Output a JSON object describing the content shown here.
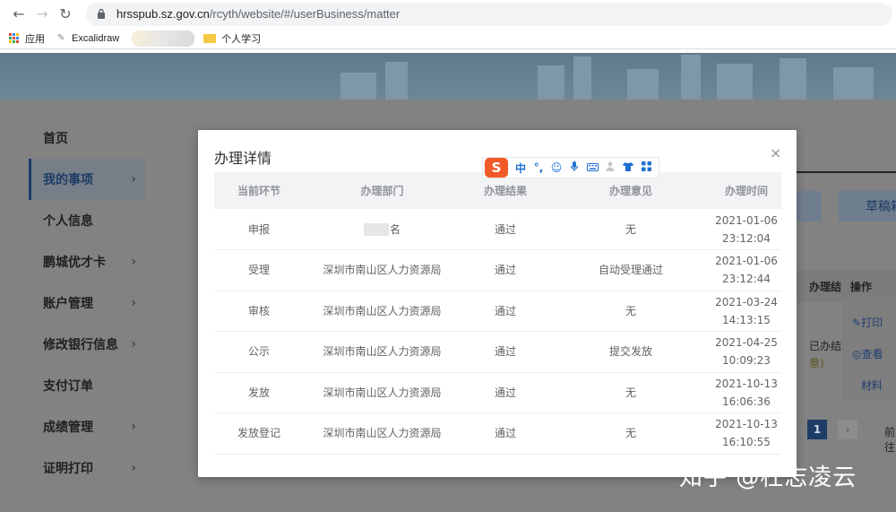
{
  "browser": {
    "url_host": "hrsspub.sz.gov.cn",
    "url_path": "/rcyth/website/#/userBusiness/matter",
    "bookmarks": [
      {
        "label": "应用"
      },
      {
        "label": "Excalidraw"
      },
      {
        "label": "个人学习"
      }
    ]
  },
  "sidebar": {
    "items": [
      {
        "label": "首页",
        "chev": ""
      },
      {
        "label": "我的事项",
        "chev": "›"
      },
      {
        "label": "个人信息",
        "chev": ""
      },
      {
        "label": "鹏城优才卡",
        "chev": "›"
      },
      {
        "label": "账户管理",
        "chev": "›"
      },
      {
        "label": "修改银行信息",
        "chev": "›"
      },
      {
        "label": "支付订单",
        "chev": ""
      },
      {
        "label": "成绩管理",
        "chev": "›"
      },
      {
        "label": "证明打印",
        "chev": "›"
      }
    ]
  },
  "background_page": {
    "draft_button": "草稿箱",
    "col_result": "办理结",
    "col_ops": "操作",
    "status_text": "已办结",
    "status_text2": "意)",
    "print_link": "打印",
    "view_link": "查看",
    "material_link": "材料",
    "page_current": "1",
    "next_label": "›",
    "prev_label": "前往"
  },
  "modal": {
    "title": "办理详情",
    "close": "×",
    "headers": [
      "当前环节",
      "办理部门",
      "办理结果",
      "办理意见",
      "办理时间"
    ],
    "rows": [
      {
        "step": "申报",
        "dept": "名",
        "result": "通过",
        "opinion": "无",
        "date": "2021-01-06",
        "time": "23:12:04"
      },
      {
        "step": "受理",
        "dept": "深圳市南山区人力资源局",
        "result": "通过",
        "opinion": "自动受理通过",
        "date": "2021-01-06",
        "time": "23:12:44"
      },
      {
        "step": "审核",
        "dept": "深圳市南山区人力资源局",
        "result": "通过",
        "opinion": "无",
        "date": "2021-03-24",
        "time": "14:13:15"
      },
      {
        "step": "公示",
        "dept": "深圳市南山区人力资源局",
        "result": "通过",
        "opinion": "提交发放",
        "date": "2021-04-25",
        "time": "10:09:23"
      },
      {
        "step": "发放",
        "dept": "深圳市南山区人力资源局",
        "result": "通过",
        "opinion": "无",
        "date": "2021-10-13",
        "time": "16:06:36"
      },
      {
        "step": "发放登记",
        "dept": "深圳市南山区人力资源局",
        "result": "通过",
        "opinion": "无",
        "date": "2021-10-13",
        "time": "16:10:55"
      }
    ]
  },
  "ime": {
    "logo": "S",
    "mode": "中",
    "punct": "°,"
  },
  "watermark": "知乎 @杜志凌云",
  "colors": {
    "brand_blue": "#1d3c66",
    "ime_orange": "#f05a28"
  }
}
